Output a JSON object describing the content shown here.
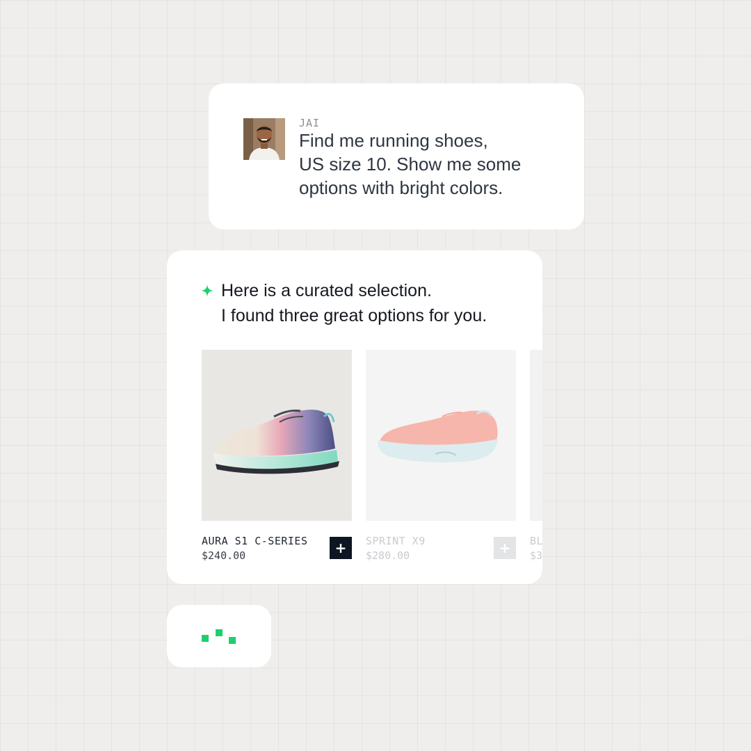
{
  "user_message": {
    "sender": "JAI",
    "text": "Find me running shoes,\nUS size 10. Show me some\noptions with bright colors.",
    "avatar_icon": "person-avatar"
  },
  "assistant_message": {
    "icon": "sparkle-icon",
    "text": "Here is a curated selection.\nI found three great options for you.",
    "accent_color": "#1ed06b"
  },
  "products": [
    {
      "name": "AURA S1 C-SERIES",
      "price": "$240.00",
      "add_label": "+",
      "image": "shoe-multicolor-gradient"
    },
    {
      "name": "SPRINT X9",
      "price": "$280.00",
      "add_label": "+",
      "image": "shoe-coral-pink"
    },
    {
      "name": "BL",
      "price": "$3",
      "add_label": "+",
      "image": "shoe-partial"
    }
  ],
  "typing_indicator": {
    "icon": "typing-dots-icon",
    "color": "#1ed06b"
  }
}
